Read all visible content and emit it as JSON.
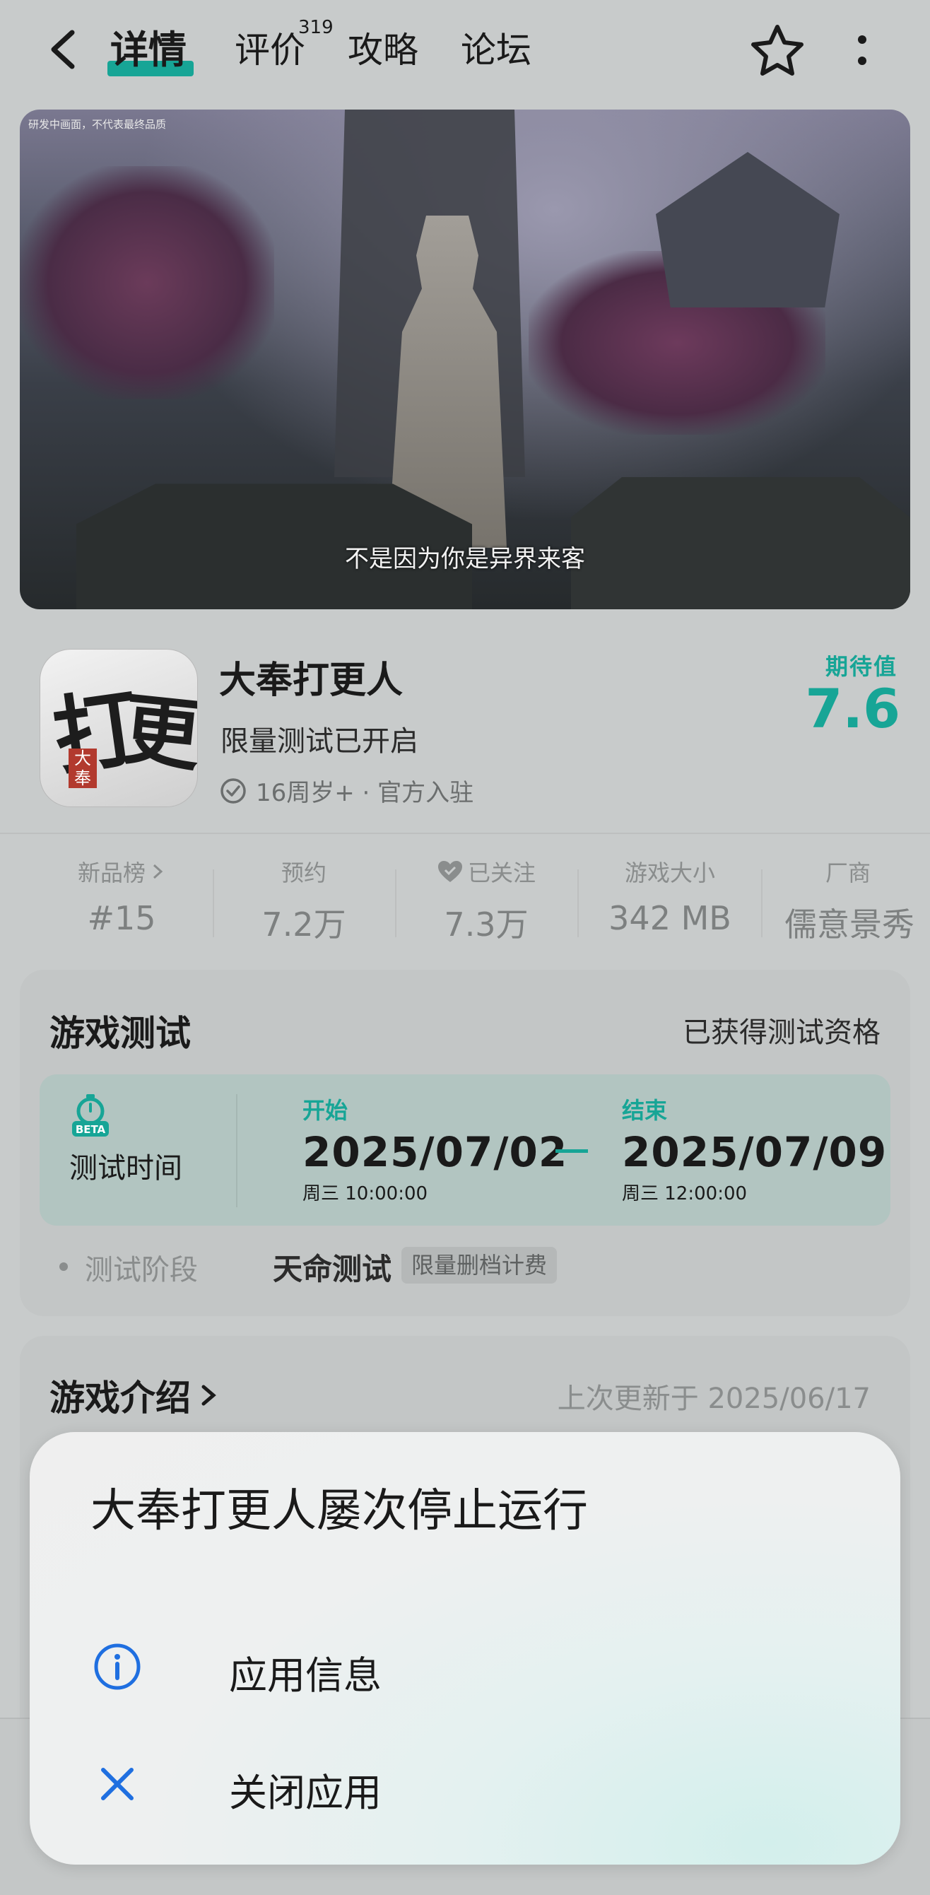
{
  "nav": {
    "tabs": [
      {
        "label": "详情"
      },
      {
        "label": "评价",
        "count": "319"
      },
      {
        "label": "攻略"
      },
      {
        "label": "论坛"
      }
    ]
  },
  "banner": {
    "watermark": "研发中画面，不代表最终品质",
    "subtitle": "不是因为你是异界来客"
  },
  "app": {
    "name": "大奉打更人",
    "status": "限量测试已开启",
    "meta": "16周岁+ · 官方入驻",
    "expect_label": "期待值",
    "expect_value": "7.6",
    "icon_text_1": "打",
    "icon_text_2": "更",
    "icon_seal": "大奉"
  },
  "stats": [
    {
      "label": "新品榜",
      "value": "#15"
    },
    {
      "label": "预约",
      "value": "7.2万"
    },
    {
      "label": "已关注",
      "value": "7.3万"
    },
    {
      "label": "游戏大小",
      "value": "342 MB"
    },
    {
      "label": "厂商",
      "value": "儒意景秀"
    }
  ],
  "test": {
    "title": "游戏测试",
    "status": "已获得测试资格",
    "time_label": "测试时间",
    "start_tag": "开始",
    "start_date": "2025/07/02",
    "start_time": "周三  10:00:00",
    "end_tag": "结束",
    "end_date": "2025/07/09",
    "end_time": "周三  12:00:00",
    "stage_label": "测试阶段",
    "stage_value": "天命测试",
    "stage_tag": "限量删档计费",
    "beta_badge": "BETA"
  },
  "intro": {
    "title": "游戏介绍",
    "updated": "上次更新于 2025/06/17"
  },
  "dialog": {
    "title": "大奉打更人屡次停止运行",
    "app_info": "应用信息",
    "close_app": "关闭应用"
  },
  "colors": {
    "accent": "#17a596",
    "dialog_blue": "#1f6fe0"
  }
}
